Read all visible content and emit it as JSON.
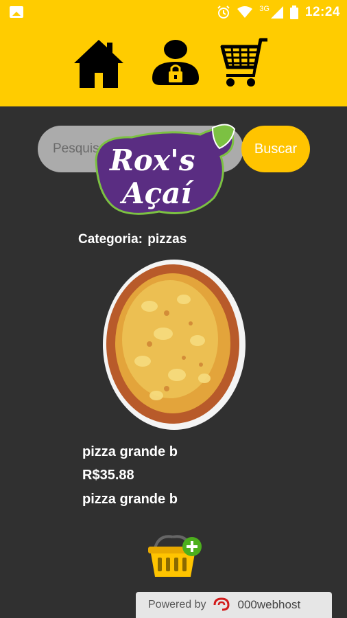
{
  "status_bar": {
    "time": "12:24",
    "network": "3G",
    "icons": [
      "image-icon",
      "alarm-icon",
      "wifi-icon",
      "signal-icon",
      "battery-icon"
    ]
  },
  "nav": {
    "items": [
      {
        "name": "home-icon"
      },
      {
        "name": "account-lock-icon"
      },
      {
        "name": "cart-icon"
      }
    ]
  },
  "search": {
    "placeholder": "Pesquisar...",
    "button_label": "Buscar"
  },
  "logo": {
    "line1": "Rox's",
    "line2": "Açaí"
  },
  "category": {
    "label": "Categoria:",
    "value": "pizzas"
  },
  "product": {
    "name": "pizza grande b",
    "price": "R$35.88",
    "description": "pizza grande b"
  },
  "footer": {
    "powered_label": "Powered by",
    "brand": "000webhost"
  },
  "colors": {
    "header": "#ffcc00",
    "background": "#303030",
    "button": "#ffc400",
    "logo_purple": "#5a2d82",
    "logo_green": "#7cc142"
  }
}
